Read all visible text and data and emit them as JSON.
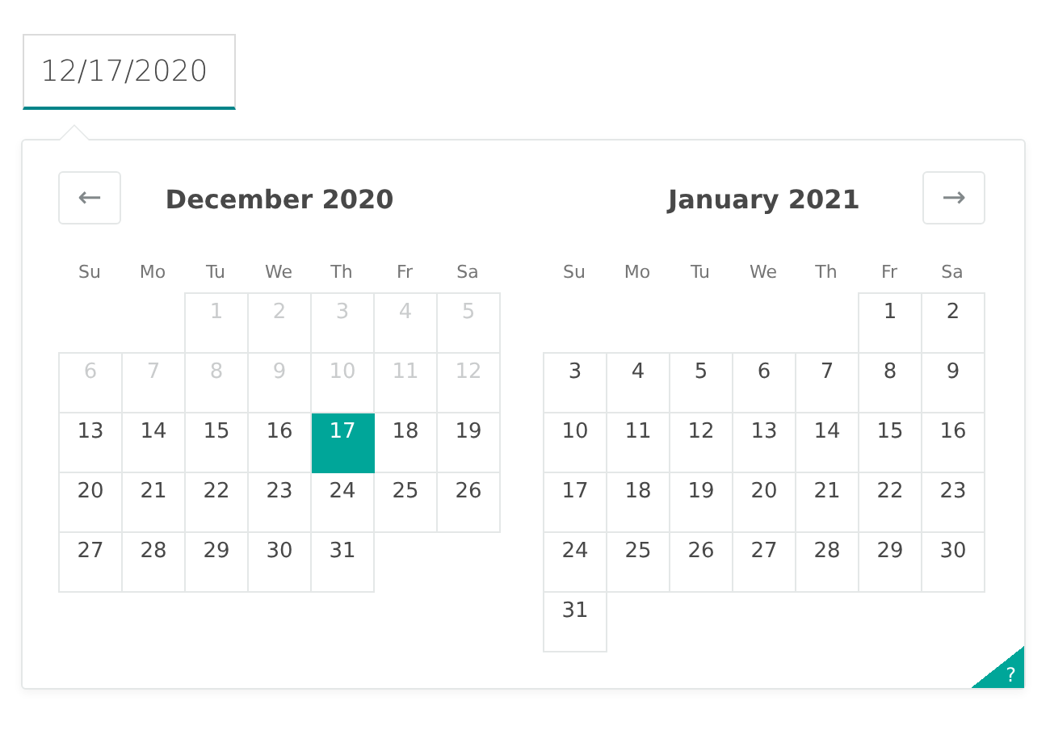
{
  "date_input": {
    "value": "12/17/2020",
    "focused": true
  },
  "nav": {
    "prev": "←",
    "next": "→"
  },
  "months": [
    {
      "title": "December 2020",
      "weekdays": [
        "Su",
        "Mo",
        "Tu",
        "We",
        "Th",
        "Fr",
        "Sa"
      ],
      "weeks": [
        {
          "days": [
            {
              "label": "1",
              "disabled": true,
              "selected": false
            },
            {
              "label": "2",
              "disabled": true,
              "selected": false
            },
            {
              "label": "3",
              "disabled": true,
              "selected": false
            },
            {
              "label": "4",
              "disabled": true,
              "selected": false
            },
            {
              "label": "5",
              "disabled": true,
              "selected": false
            }
          ]
        },
        {
          "days": [
            {
              "label": "6",
              "disabled": true,
              "selected": false
            },
            {
              "label": "7",
              "disabled": true,
              "selected": false
            },
            {
              "label": "8",
              "disabled": true,
              "selected": false
            },
            {
              "label": "9",
              "disabled": true,
              "selected": false
            },
            {
              "label": "10",
              "disabled": true,
              "selected": false
            },
            {
              "label": "11",
              "disabled": true,
              "selected": false
            },
            {
              "label": "12",
              "disabled": true,
              "selected": false
            }
          ]
        },
        {
          "days": [
            {
              "label": "13",
              "disabled": false,
              "selected": false
            },
            {
              "label": "14",
              "disabled": false,
              "selected": false
            },
            {
              "label": "15",
              "disabled": false,
              "selected": false
            },
            {
              "label": "16",
              "disabled": false,
              "selected": false
            },
            {
              "label": "17",
              "disabled": false,
              "selected": true
            },
            {
              "label": "18",
              "disabled": false,
              "selected": false
            },
            {
              "label": "19",
              "disabled": false,
              "selected": false
            }
          ]
        },
        {
          "days": [
            {
              "label": "20",
              "disabled": false,
              "selected": false
            },
            {
              "label": "21",
              "disabled": false,
              "selected": false
            },
            {
              "label": "22",
              "disabled": false,
              "selected": false
            },
            {
              "label": "23",
              "disabled": false,
              "selected": false
            },
            {
              "label": "24",
              "disabled": false,
              "selected": false
            },
            {
              "label": "25",
              "disabled": false,
              "selected": false
            },
            {
              "label": "26",
              "disabled": false,
              "selected": false
            }
          ]
        },
        {
          "days": [
            {
              "label": "27",
              "disabled": false,
              "selected": false
            },
            {
              "label": "28",
              "disabled": false,
              "selected": false
            },
            {
              "label": "29",
              "disabled": false,
              "selected": false
            },
            {
              "label": "30",
              "disabled": false,
              "selected": false
            },
            {
              "label": "31",
              "disabled": false,
              "selected": false
            }
          ]
        }
      ]
    },
    {
      "title": "January 2021",
      "weekdays": [
        "Su",
        "Mo",
        "Tu",
        "We",
        "Th",
        "Fr",
        "Sa"
      ],
      "weeks": [
        {
          "days": [
            {
              "label": "1",
              "disabled": false,
              "selected": false
            },
            {
              "label": "2",
              "disabled": false,
              "selected": false
            }
          ]
        },
        {
          "days": [
            {
              "label": "3",
              "disabled": false,
              "selected": false
            },
            {
              "label": "4",
              "disabled": false,
              "selected": false
            },
            {
              "label": "5",
              "disabled": false,
              "selected": false
            },
            {
              "label": "6",
              "disabled": false,
              "selected": false
            },
            {
              "label": "7",
              "disabled": false,
              "selected": false
            },
            {
              "label": "8",
              "disabled": false,
              "selected": false
            },
            {
              "label": "9",
              "disabled": false,
              "selected": false
            }
          ]
        },
        {
          "days": [
            {
              "label": "10",
              "disabled": false,
              "selected": false
            },
            {
              "label": "11",
              "disabled": false,
              "selected": false
            },
            {
              "label": "12",
              "disabled": false,
              "selected": false
            },
            {
              "label": "13",
              "disabled": false,
              "selected": false
            },
            {
              "label": "14",
              "disabled": false,
              "selected": false
            },
            {
              "label": "15",
              "disabled": false,
              "selected": false
            },
            {
              "label": "16",
              "disabled": false,
              "selected": false
            }
          ]
        },
        {
          "days": [
            {
              "label": "17",
              "disabled": false,
              "selected": false
            },
            {
              "label": "18",
              "disabled": false,
              "selected": false
            },
            {
              "label": "19",
              "disabled": false,
              "selected": false
            },
            {
              "label": "20",
              "disabled": false,
              "selected": false
            },
            {
              "label": "21",
              "disabled": false,
              "selected": false
            },
            {
              "label": "22",
              "disabled": false,
              "selected": false
            },
            {
              "label": "23",
              "disabled": false,
              "selected": false
            }
          ]
        },
        {
          "days": [
            {
              "label": "24",
              "disabled": false,
              "selected": false
            },
            {
              "label": "25",
              "disabled": false,
              "selected": false
            },
            {
              "label": "26",
              "disabled": false,
              "selected": false
            },
            {
              "label": "27",
              "disabled": false,
              "selected": false
            },
            {
              "label": "28",
              "disabled": false,
              "selected": false
            },
            {
              "label": "29",
              "disabled": false,
              "selected": false
            },
            {
              "label": "30",
              "disabled": false,
              "selected": false
            }
          ]
        },
        {
          "days": [
            {
              "label": "31",
              "disabled": false,
              "selected": false
            }
          ]
        }
      ]
    }
  ],
  "help": {
    "label": "?"
  }
}
